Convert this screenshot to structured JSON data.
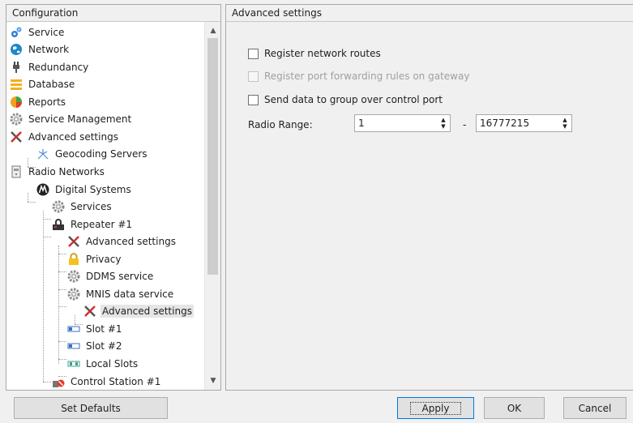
{
  "left_panel": {
    "header": "Configuration",
    "tree": [
      {
        "label": "Service",
        "icon": "gears-icon",
        "level": 0
      },
      {
        "label": "Network",
        "icon": "globe-icon",
        "level": 0
      },
      {
        "label": "Redundancy",
        "icon": "plug-icon",
        "level": 0
      },
      {
        "label": "Database",
        "icon": "database-icon",
        "level": 0
      },
      {
        "label": "Reports",
        "icon": "reports-icon",
        "level": 0
      },
      {
        "label": "Service Management",
        "icon": "gear-icon",
        "level": 0
      },
      {
        "label": "Advanced settings",
        "icon": "tools-icon",
        "level": 0
      },
      {
        "label": "Geocoding Servers",
        "icon": "geocoding-icon",
        "level": 1
      },
      {
        "label": "Radio Networks",
        "icon": "radio-icon",
        "level": 0
      },
      {
        "label": "Digital Systems",
        "icon": "motorola-logo-icon",
        "level": 1
      },
      {
        "label": "Services",
        "icon": "gear-icon",
        "level": 2
      },
      {
        "label": "Repeater #1",
        "icon": "repeater-icon",
        "level": 2
      },
      {
        "label": "Advanced settings",
        "icon": "tools-icon",
        "level": 3
      },
      {
        "label": "Privacy",
        "icon": "lock-icon",
        "level": 3
      },
      {
        "label": "DDMS service",
        "icon": "gear-icon",
        "level": 3
      },
      {
        "label": "MNIS data service",
        "icon": "gear-icon",
        "level": 3
      },
      {
        "label": "Advanced settings",
        "icon": "tools-icon",
        "level": 4,
        "selected": true
      },
      {
        "label": "Slot #1",
        "icon": "slot-icon",
        "level": 3
      },
      {
        "label": "Slot #2",
        "icon": "slot-icon",
        "level": 3
      },
      {
        "label": "Local Slots",
        "icon": "local-slots-icon",
        "level": 3
      },
      {
        "label": "Control Station #1",
        "icon": "control-station-icon",
        "level": 2
      }
    ]
  },
  "right_panel": {
    "header": "Advanced settings",
    "checkboxes": [
      {
        "label": "Register network routes",
        "checked": false,
        "enabled": true
      },
      {
        "label": "Register port forwarding rules on gateway",
        "checked": false,
        "enabled": false
      },
      {
        "label": "Send data to group over control port",
        "checked": false,
        "enabled": true
      }
    ],
    "radio_range": {
      "label": "Radio Range:",
      "from": "1",
      "separator": "-",
      "to": "16777215"
    }
  },
  "buttons": {
    "set_defaults": "Set Defaults",
    "apply": "Apply",
    "ok": "OK",
    "cancel": "Cancel"
  }
}
